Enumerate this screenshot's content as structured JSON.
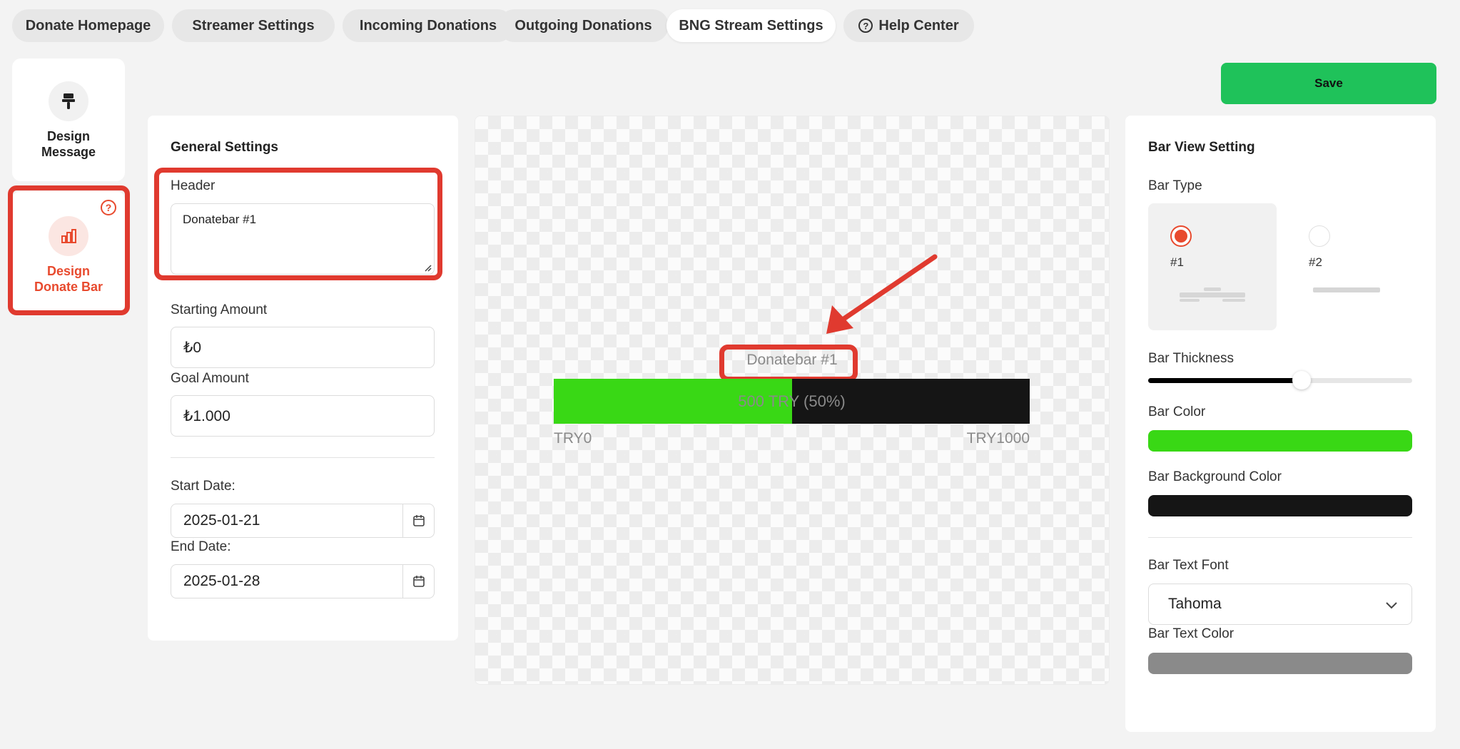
{
  "nav": {
    "tabs": [
      {
        "label": "Donate Homepage"
      },
      {
        "label": "Streamer Settings"
      },
      {
        "label": "Incoming Donations"
      },
      {
        "label": "Outgoing Donations"
      },
      {
        "label": "BNG Stream Settings"
      },
      {
        "label": "Help Center"
      }
    ],
    "active_tab": "BNG Stream Settings"
  },
  "sidebar": {
    "items": [
      {
        "label": "Design Message",
        "icon": "paintbrush-icon",
        "active": false
      },
      {
        "label": "Design Donate Bar",
        "icon": "bar-chart-icon",
        "active": true
      }
    ]
  },
  "actions": {
    "save_label": "Save"
  },
  "general": {
    "title": "General Settings",
    "header_label": "Header",
    "header_value": "Donatebar #1",
    "starting_label": "Starting Amount",
    "starting_value": "₺0",
    "goal_label": "Goal Amount",
    "goal_value": "₺1.000",
    "start_date_label": "Start Date:",
    "start_date_value": "2025-01-21",
    "end_date_label": "End Date:",
    "end_date_value": "2025-01-28"
  },
  "preview": {
    "header": "Donatebar #1",
    "bar_text": "500 TRY (50%)",
    "progress": 0.5,
    "min_label": "TRY0",
    "max_label": "TRY1000"
  },
  "bar_view": {
    "title": "Bar View Setting",
    "bar_type_label": "Bar Type",
    "options": [
      {
        "label": "#1",
        "selected": true
      },
      {
        "label": "#2",
        "selected": false
      }
    ],
    "thickness_label": "Bar Thickness",
    "thickness": 0.58,
    "bar_color_label": "Bar Color",
    "bar_color": "#39d815",
    "bar_bg_color_label": "Bar Background Color",
    "bar_bg_color": "#151515",
    "font_label": "Bar Text Font",
    "font_value": "Tahoma",
    "text_color_label": "Bar Text Color",
    "text_color": "#8a8a8a"
  },
  "colors": {
    "accent": "#e84a2e",
    "save": "#1fc25a",
    "highlight": "#e03a2f"
  }
}
